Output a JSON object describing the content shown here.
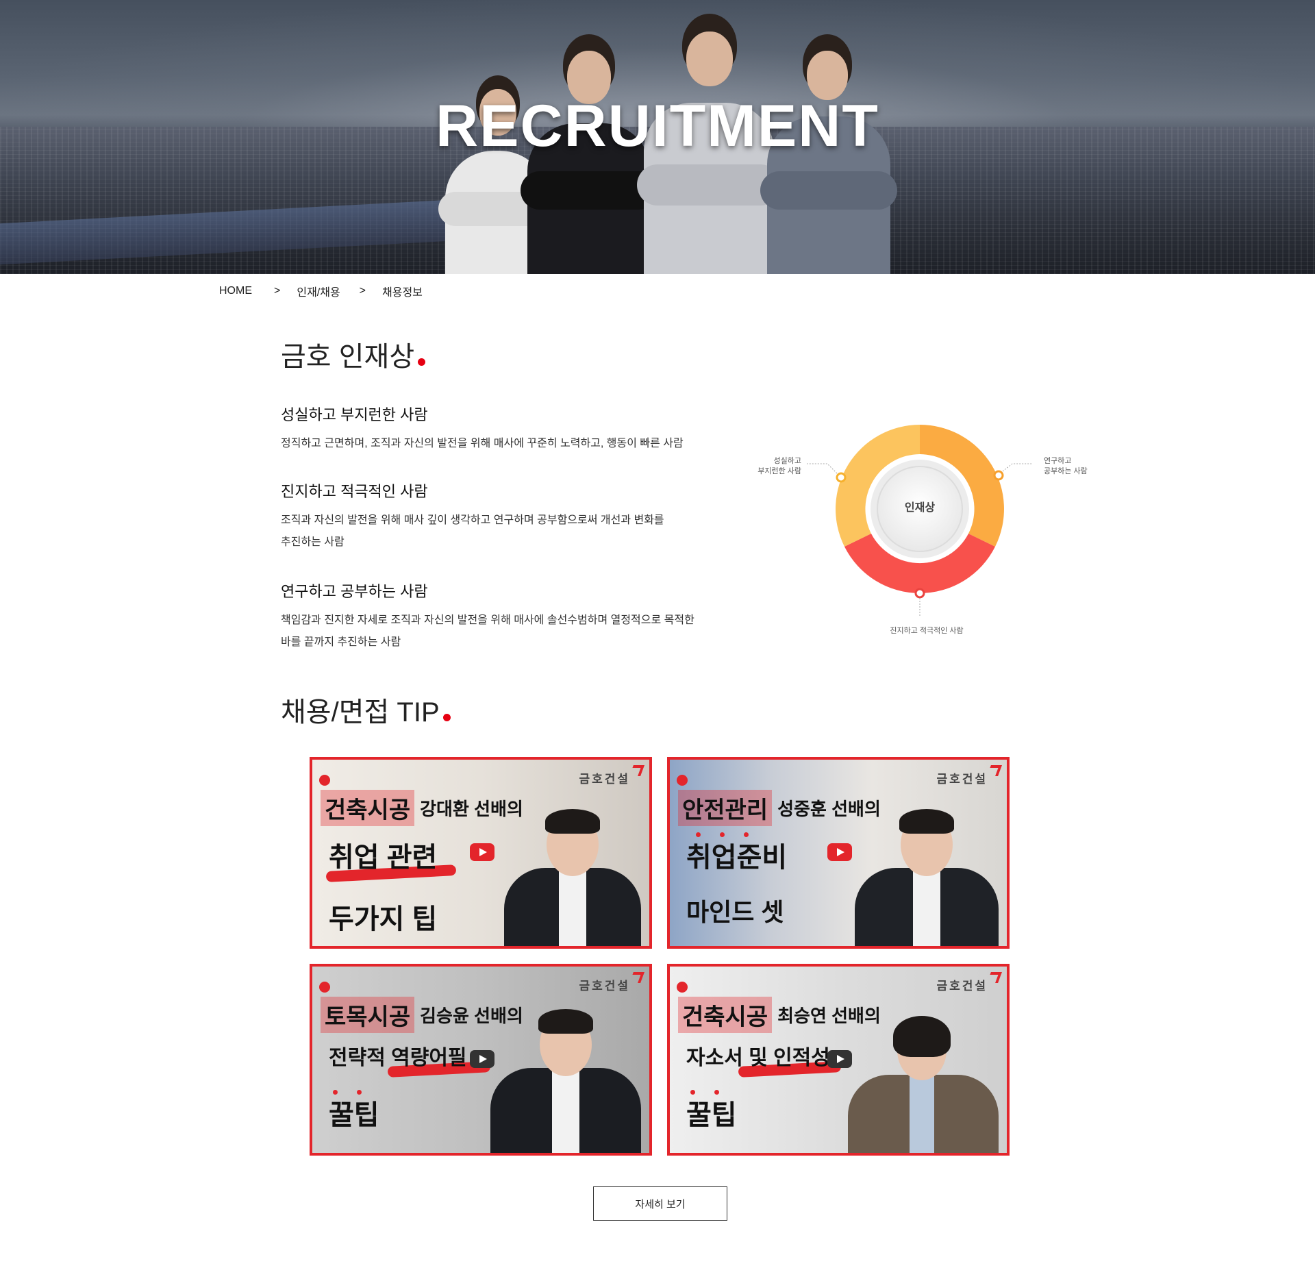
{
  "hero": {
    "title": "RECRUITMENT"
  },
  "breadcrumb": {
    "items": [
      "HOME",
      "인재/채용",
      "채용정보"
    ],
    "separator": ">"
  },
  "talent_section": {
    "title": "금호 인재상",
    "items": [
      {
        "heading": "성실하고 부지런한 사람",
        "desc": "정직하고 근면하며, 조직과 자신의 발전을 위해 매사에 꾸준히 노력하고, 행동이 빠른 사람"
      },
      {
        "heading": "진지하고 적극적인 사람",
        "desc_lines": [
          "조직과 자신의 발전을 위해 매사 깊이 생각하고 연구하며 공부함으로써 개선과 변화를",
          "추진하는 사람"
        ]
      },
      {
        "heading": "연구하고 공부하는 사람",
        "desc_lines": [
          "책임감과 진지한 자세로 조직과 자신의 발전을 위해 매사에 솔선수범하며 열정적으로 목적한",
          "바를 끝까지 추진하는 사람"
        ]
      }
    ],
    "diagram": {
      "center": "인재상",
      "label_left": [
        "성실하고",
        "부지런한 사람"
      ],
      "label_right": [
        "연구하고",
        "공부하는 사람"
      ],
      "label_bottom": "진지하고 적극적인 사람",
      "colors": {
        "left": "#fcc45e",
        "right": "#fbab42",
        "bottom": "#f8514c"
      }
    }
  },
  "tip_section": {
    "title": "채용/면접 TIP",
    "cards": [
      {
        "brand": "금호건설",
        "tag": "건축시공",
        "who": "강대환 선배의",
        "line2": "취업 관련",
        "line3": "두가지 팁"
      },
      {
        "brand": "금호건설",
        "tag": "안전관리",
        "who": "성중훈 선배의",
        "line2": "취업준비",
        "line3": "마인드 셋"
      },
      {
        "brand": "금호건설",
        "tag": "토목시공",
        "who": "김승윤 선배의",
        "line2": "전략적 역량어필",
        "line3": "꿀팁"
      },
      {
        "brand": "금호건설",
        "tag": "건축시공",
        "who": "최승연 선배의",
        "line2": "자소서 및 인적성",
        "line3": "꿀팁"
      }
    ],
    "more_label": "자세히 보기"
  },
  "colors": {
    "accent": "#e60012",
    "card_border": "#e3252b"
  }
}
